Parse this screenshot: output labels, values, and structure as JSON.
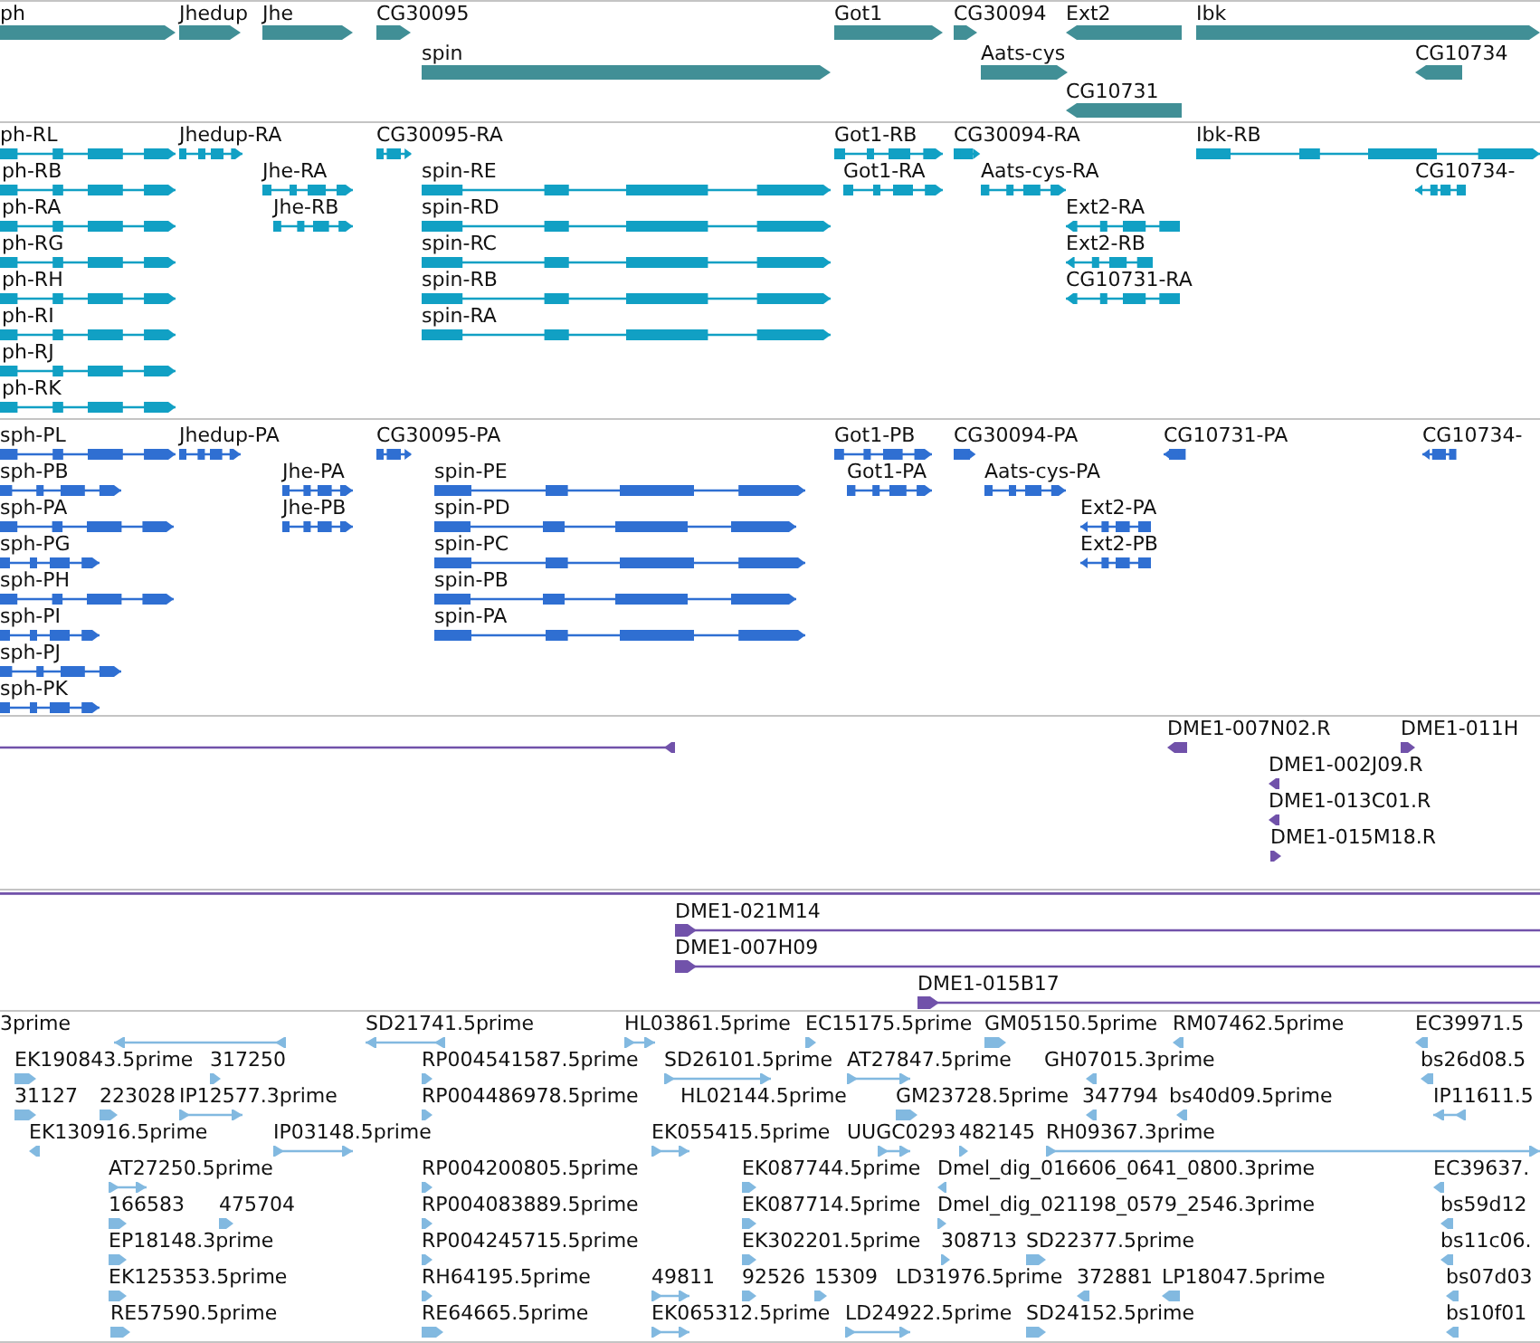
{
  "tracks": [
    {
      "kind": "gene",
      "features": [
        {
          "label": "ph",
          "reverse": false
        },
        {
          "label": "Jhedup",
          "reverse": false
        },
        {
          "label": "Jhe",
          "reverse": false
        },
        {
          "label": "CG30095",
          "reverse": false
        },
        {
          "label": "Got1",
          "reverse": false
        },
        {
          "label": "CG30094",
          "reverse": false
        },
        {
          "label": "Ext2",
          "reverse": true
        },
        {
          "label": "Ibk",
          "reverse": false
        },
        {
          "label": "spin",
          "reverse": false
        },
        {
          "label": "Aats-cys",
          "reverse": false
        },
        {
          "label": "CG10734",
          "reverse": true
        },
        {
          "label": "CG10731",
          "reverse": true
        }
      ]
    },
    {
      "kind": "transcript",
      "features": [
        {
          "label": "ph-RL",
          "reverse": false
        },
        {
          "label": "Jhedup-RA",
          "reverse": false
        },
        {
          "label": "CG30095-RA",
          "reverse": false
        },
        {
          "label": "Got1-RB",
          "reverse": false
        },
        {
          "label": "CG30094-RA",
          "reverse": false
        },
        {
          "label": "Ibk-RB",
          "reverse": false
        },
        {
          "label": "ph-RB",
          "reverse": false
        },
        {
          "label": "Jhe-RA",
          "reverse": false
        },
        {
          "label": "spin-RE",
          "reverse": false
        },
        {
          "label": "Got1-RA",
          "reverse": false
        },
        {
          "label": "Aats-cys-RA",
          "reverse": false
        },
        {
          "label": "CG10734-",
          "reverse": true
        },
        {
          "label": "ph-RA",
          "reverse": false
        },
        {
          "label": "Jhe-RB",
          "reverse": false
        },
        {
          "label": "spin-RD",
          "reverse": false
        },
        {
          "label": "Ext2-RA",
          "reverse": true
        },
        {
          "label": "ph-RG",
          "reverse": false
        },
        {
          "label": "spin-RC",
          "reverse": false
        },
        {
          "label": "Ext2-RB",
          "reverse": true
        },
        {
          "label": "ph-RH",
          "reverse": false
        },
        {
          "label": "spin-RB",
          "reverse": false
        },
        {
          "label": "CG10731-RA",
          "reverse": true
        },
        {
          "label": "ph-RI",
          "reverse": false
        },
        {
          "label": "spin-RA",
          "reverse": false
        },
        {
          "label": "ph-RJ",
          "reverse": false
        },
        {
          "label": "ph-RK",
          "reverse": false
        }
      ]
    },
    {
      "kind": "protein",
      "features": [
        {
          "label": "sph-PL",
          "reverse": false
        },
        {
          "label": "Jhedup-PA",
          "reverse": false
        },
        {
          "label": "CG30095-PA",
          "reverse": false
        },
        {
          "label": "Got1-PB",
          "reverse": false
        },
        {
          "label": "CG30094-PA",
          "reverse": false
        },
        {
          "label": "CG10731-PA",
          "reverse": true
        },
        {
          "label": "CG10734-",
          "reverse": true
        },
        {
          "label": "sph-PB",
          "reverse": false
        },
        {
          "label": "Jhe-PA",
          "reverse": false
        },
        {
          "label": "spin-PE",
          "reverse": false
        },
        {
          "label": "Got1-PA",
          "reverse": false
        },
        {
          "label": "Aats-cys-PA",
          "reverse": false
        },
        {
          "label": "sph-PA",
          "reverse": false
        },
        {
          "label": "Jhe-PB",
          "reverse": false
        },
        {
          "label": "spin-PD",
          "reverse": false
        },
        {
          "label": "Ext2-PA",
          "reverse": true
        },
        {
          "label": "sph-PG",
          "reverse": false
        },
        {
          "label": "spin-PC",
          "reverse": false
        },
        {
          "label": "Ext2-PB",
          "reverse": true
        },
        {
          "label": "sph-PH",
          "reverse": false
        },
        {
          "label": "spin-PB",
          "reverse": false
        },
        {
          "label": "sph-PI",
          "reverse": false
        },
        {
          "label": "spin-PA",
          "reverse": false
        },
        {
          "label": "sph-PJ",
          "reverse": false
        },
        {
          "label": "sph-PK",
          "reverse": false
        }
      ]
    },
    {
      "kind": "bac_end",
      "features": [
        {
          "reverse": true
        },
        {
          "label": "DME1-007N02.R",
          "reverse": true
        },
        {
          "label": "DME1-011H",
          "reverse": false
        },
        {
          "label": "DME1-002J09.R",
          "reverse": true
        },
        {
          "label": "DME1-013C01.R",
          "reverse": true
        },
        {
          "label": "DME1-015M18.R",
          "reverse": false
        }
      ]
    },
    {
      "kind": "bac",
      "features": [
        {
          "label": "DME1-021M14",
          "reverse": false
        },
        {
          "label": "DME1-007H09",
          "reverse": false
        },
        {
          "label": "DME1-015B17",
          "reverse": false
        }
      ]
    },
    {
      "kind": "est",
      "features": [
        {
          "label": "3prime",
          "reverse": true
        },
        {
          "label": "SD21741.5prime",
          "reverse": true
        },
        {
          "label": "HL03861.5prime",
          "reverse": false
        },
        {
          "label": "EC15175.5prime",
          "reverse": false
        },
        {
          "label": "GM05150.5prime",
          "reverse": false
        },
        {
          "label": "RM07462.5prime",
          "reverse": true
        },
        {
          "label": "EC39971.5",
          "reverse": true
        },
        {
          "label": "EK190843.5prime",
          "reverse": false
        },
        {
          "label": "317250",
          "reverse": false
        },
        {
          "label": "RP004541587.5prime",
          "reverse": false
        },
        {
          "label": "SD26101.5prime",
          "reverse": false
        },
        {
          "label": "AT27847.5prime",
          "reverse": false
        },
        {
          "label": "GH07015.3prime",
          "reverse": true
        },
        {
          "label": "bs26d08.5",
          "reverse": true
        },
        {
          "label": "31127",
          "reverse": false
        },
        {
          "label": "223028",
          "reverse": false
        },
        {
          "label": "IP12577.3prime",
          "reverse": false
        },
        {
          "label": "RP004486978.5prime",
          "reverse": false
        },
        {
          "label": "HL02144.5prime"
        },
        {
          "label": "GM23728.5prime",
          "reverse": false
        },
        {
          "label": "347794",
          "reverse": true
        },
        {
          "label": "bs40d09.5prime",
          "reverse": true
        },
        {
          "label": "IP11611.5",
          "reverse": true
        },
        {
          "label": "EK130916.5prime",
          "reverse": true
        },
        {
          "label": "IP03148.5prime",
          "reverse": false
        },
        {
          "label": "EK055415.5prime",
          "reverse": false
        },
        {
          "label": "UUGC0293",
          "reverse": false
        },
        {
          "label": "482145",
          "reverse": false
        },
        {
          "label": "RH09367.3prime",
          "reverse": false
        },
        {
          "label": "AT27250.5prime",
          "reverse": false
        },
        {
          "label": "RP004200805.5prime",
          "reverse": false
        },
        {
          "label": "EK087744.5prime",
          "reverse": false
        },
        {
          "label": "Dmel_dig_016606_0641_0800.3prime",
          "reverse": true
        },
        {
          "label": "EC39637.",
          "reverse": true
        },
        {
          "label": "166583",
          "reverse": false
        },
        {
          "label": "475704",
          "reverse": false
        },
        {
          "label": "RP004083889.5prime",
          "reverse": false
        },
        {
          "label": "EK087714.5prime",
          "reverse": false
        },
        {
          "label": "Dmel_dig_021198_0579_2546.3prime",
          "reverse": false
        },
        {
          "label": "bs59d12",
          "reverse": true
        },
        {
          "label": "EP18148.3prime",
          "reverse": false
        },
        {
          "label": "RP004245715.5prime",
          "reverse": false
        },
        {
          "label": "EK302201.5prime",
          "reverse": false
        },
        {
          "label": "308713",
          "reverse": false
        },
        {
          "label": "SD22377.5prime",
          "reverse": false
        },
        {
          "label": "bs11c06.",
          "reverse": true
        },
        {
          "label": "EK125353.5prime",
          "reverse": false
        },
        {
          "label": "RH64195.5prime",
          "reverse": false
        },
        {
          "label": "49811",
          "reverse": false
        },
        {
          "label": "92526",
          "reverse": false
        },
        {
          "label": "15309",
          "reverse": false
        },
        {
          "label": "LD31976.5prime"
        },
        {
          "label": "372881",
          "reverse": true
        },
        {
          "label": "LP18047.5prime",
          "reverse": true
        },
        {
          "label": "bs07d03",
          "reverse": true
        },
        {
          "label": "RE57590.5prime",
          "reverse": false
        },
        {
          "label": "RE64665.5prime",
          "reverse": false
        },
        {
          "label": "EK065312.5prime",
          "reverse": false
        },
        {
          "label": "LD24922.5prime",
          "reverse": false
        },
        {
          "label": "SD24152.5prime",
          "reverse": false
        },
        {
          "label": "bs10f01",
          "reverse": true
        }
      ]
    }
  ]
}
